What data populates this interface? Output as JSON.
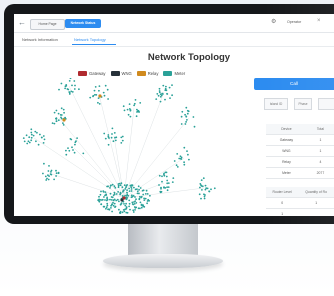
{
  "topbar": {
    "back_icon": "arrow-left-icon",
    "tab_home": "Home Page",
    "tab_active": "Network Status",
    "settings_icon": "gear-icon",
    "user_label": "Operator",
    "close_icon": "close-icon"
  },
  "subtabs": {
    "info": "Network Information",
    "topology": "Network Topology"
  },
  "main": {
    "title": "Network Topology",
    "legend": [
      {
        "label": "Gateway",
        "color": "#b02a2f"
      },
      {
        "label": "WNG",
        "color": "#27313a"
      },
      {
        "label": "Relay",
        "color": "#d08a1e"
      },
      {
        "label": "Meter",
        "color": "#2aa198"
      }
    ]
  },
  "panel": {
    "call_button": "Call",
    "filter": {
      "select1": "Island ID",
      "select2": "Phase"
    },
    "device_table": {
      "headers": [
        "Device",
        "Total"
      ],
      "rows": [
        [
          "Gateway",
          "1"
        ],
        [
          "WNG",
          "1"
        ],
        [
          "Relay",
          "4"
        ],
        [
          "Meter",
          "2077"
        ]
      ]
    },
    "router_table": {
      "headers": [
        "Router Level",
        "Quantity of Ro"
      ],
      "rows": [
        [
          "0",
          "1"
        ],
        [
          "1",
          ""
        ]
      ]
    }
  },
  "colors": {
    "accent": "#2d8cf0",
    "node": "#2aa198",
    "bezel": "#15171a"
  }
}
